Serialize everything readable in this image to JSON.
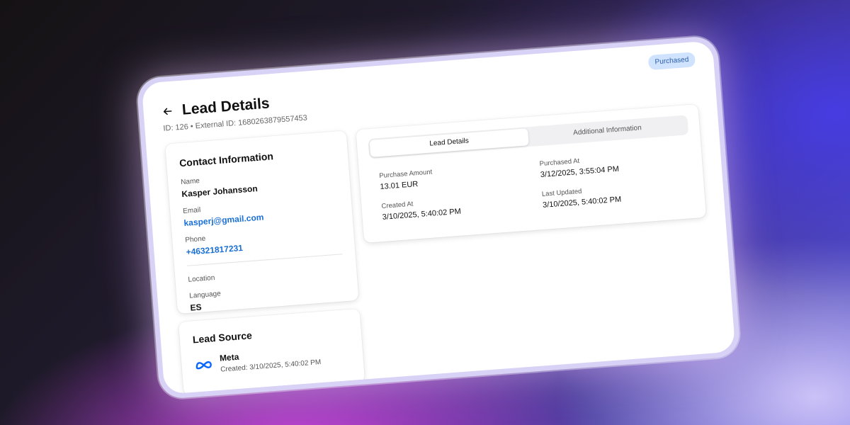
{
  "header": {
    "title": "Lead Details",
    "subtitle": "ID: 126 • External ID: 1680263879557453",
    "status": "Purchased"
  },
  "contact": {
    "title": "Contact Information",
    "name_label": "Name",
    "name": "Kasper Johansson",
    "email_label": "Email",
    "email": "kasperj@gmail.com",
    "phone_label": "Phone",
    "phone": "+46321817231",
    "location_label": "Location",
    "language_label": "Language",
    "language": "ES"
  },
  "source": {
    "title": "Lead Source",
    "name": "Meta",
    "created": "Created: 3/10/2025, 5:40:02 PM",
    "icon": "meta-icon"
  },
  "tabs": [
    {
      "label": "Lead Details",
      "active": true
    },
    {
      "label": "Additional Information",
      "active": false
    }
  ],
  "details": {
    "purchase_amount_label": "Purchase Amount",
    "purchase_amount": "13.01 EUR",
    "purchased_at_label": "Purchased At",
    "purchased_at": "3/12/2025, 3:55:04 PM",
    "created_at_label": "Created At",
    "created_at": "3/10/2025, 5:40:02 PM",
    "last_updated_label": "Last Updated",
    "last_updated": "3/10/2025, 5:40:02 PM"
  },
  "colors": {
    "link": "#1a6fd6",
    "badge_bg": "#cfe3ff",
    "badge_text": "#2c5fa8",
    "meta_brand": "#0866ff"
  }
}
